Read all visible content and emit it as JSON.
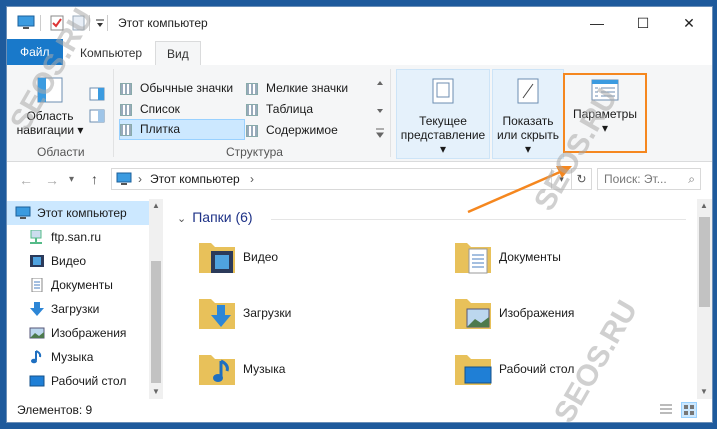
{
  "window": {
    "title": "Этот компьютер",
    "minimize": "—",
    "maximize": "☐",
    "close": "✕"
  },
  "tabs": {
    "file": "Файл",
    "computer": "Компьютер",
    "view": "Вид"
  },
  "ribbon": {
    "nav_pane_line1": "Область",
    "nav_pane_line2": "навигации",
    "panels_group": "Области",
    "layout_group": "Структура",
    "layout_items": [
      "Обычные значки",
      "Мелкие значки",
      "Список",
      "Таблица",
      "Плитка",
      "Содержимое"
    ],
    "current_view_line1": "Текущее",
    "current_view_line2": "представление",
    "show_hide_line1": "Показать",
    "show_hide_line2": "или скрыть",
    "options": "Параметры"
  },
  "address": {
    "path": "Этот компьютер",
    "search_placeholder": "Поиск: Эт..."
  },
  "nav": {
    "items": [
      "Этот компьютер",
      "ftp.san.ru",
      "Видео",
      "Документы",
      "Загрузки",
      "Изображения",
      "Музыка",
      "Рабочий стол"
    ]
  },
  "content": {
    "group_header": "Папки (6)",
    "folders": [
      "Видео",
      "Документы",
      "Загрузки",
      "Изображения",
      "Музыка",
      "Рабочий стол"
    ]
  },
  "status": {
    "items_count": "Элементов: 9"
  },
  "watermark": "SEOS.RU",
  "colors": {
    "accent": "#1979ca",
    "highlight": "#f5871f",
    "selection": "#cce8ff"
  }
}
